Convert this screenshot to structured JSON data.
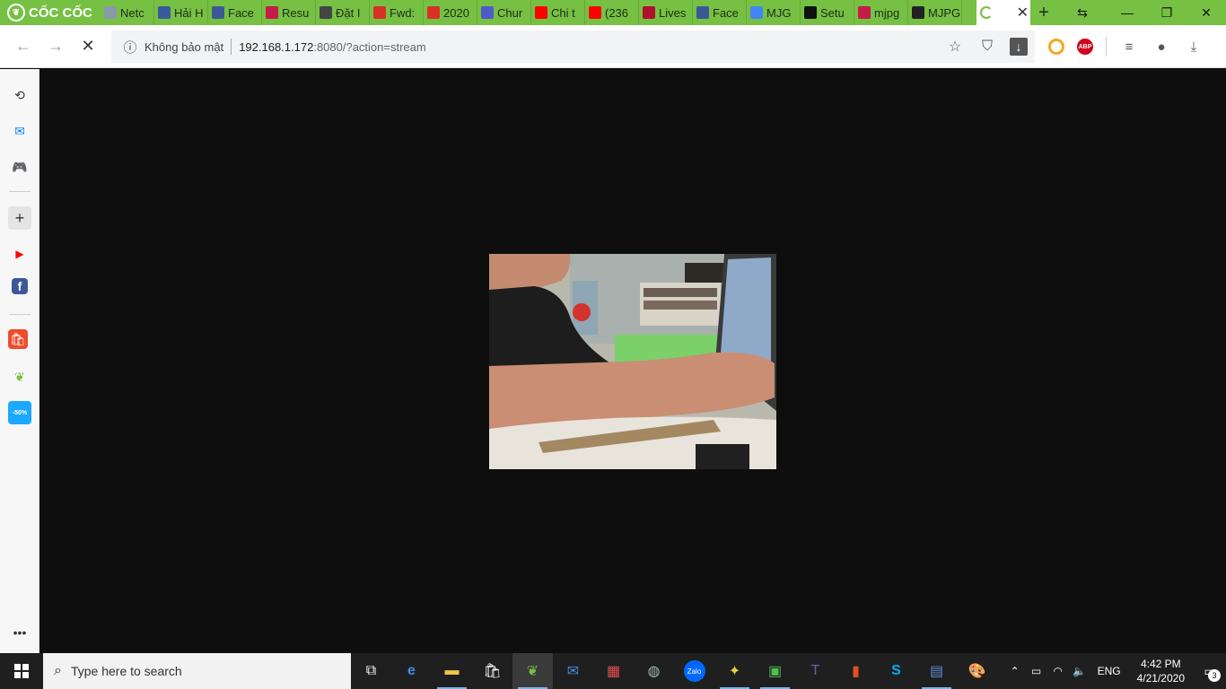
{
  "browser": {
    "brand": "CỐC CỐC",
    "tabs": [
      {
        "title": "Netc",
        "icon": "scissors-icon",
        "color": "#8899aa"
      },
      {
        "title": "Hải H",
        "icon": "facebook-icon",
        "color": "#3b5998"
      },
      {
        "title": "Face",
        "icon": "facebook-icon",
        "color": "#3b5998"
      },
      {
        "title": "Resu",
        "icon": "raspberry-icon",
        "color": "#c51a4a"
      },
      {
        "title": "Đặt I",
        "icon": "globe-icon",
        "color": "#444444"
      },
      {
        "title": "Fwd:",
        "icon": "gmail-icon",
        "color": "#d93025"
      },
      {
        "title": "2020",
        "icon": "gmail-icon",
        "color": "#d93025"
      },
      {
        "title": "Chur",
        "icon": "teams-icon",
        "color": "#5059c9"
      },
      {
        "title": "Chi t",
        "icon": "youtube-icon",
        "color": "#ff0000"
      },
      {
        "title": "(236",
        "icon": "youtube-icon",
        "color": "#ff0000"
      },
      {
        "title": "Lives",
        "icon": "r-icon",
        "color": "#b10f2e"
      },
      {
        "title": "Face",
        "icon": "facebook-icon",
        "color": "#3b5998"
      },
      {
        "title": "MJG",
        "icon": "google-icon",
        "color": "#4285f4"
      },
      {
        "title": "Setu",
        "icon": "github-icon",
        "color": "#111111"
      },
      {
        "title": "mjpg",
        "icon": "raspberry-icon",
        "color": "#c51a4a"
      },
      {
        "title": "MJPG",
        "icon": "terminal-icon",
        "color": "#222222"
      }
    ],
    "active_tab": {
      "title": "",
      "icon": "loading-icon"
    },
    "toolbar": {
      "security_label": "Không bảo mật",
      "url_host": "192.168.1.172",
      "url_rest": ":8080/?action=stream"
    }
  },
  "sidebar": {
    "items": [
      {
        "name": "history-icon",
        "glyph": "⟲",
        "color": "#333333"
      },
      {
        "name": "messenger-icon",
        "glyph": "✉",
        "color": "#0084ff"
      },
      {
        "name": "game-icon",
        "glyph": "🎮",
        "color": "#43a047"
      },
      {
        "name": "add-icon",
        "glyph": "+",
        "color": "#333333"
      },
      {
        "name": "youtube-icon",
        "glyph": "▶",
        "color": "#ff0000"
      },
      {
        "name": "facebook-icon",
        "glyph": "f",
        "color": "#3b5998"
      },
      {
        "name": "shopee-icon",
        "glyph": "🛍",
        "color": "#ee4d2d"
      },
      {
        "name": "coccoc-leaf-icon",
        "glyph": "❦",
        "color": "#76c043"
      },
      {
        "name": "tiki-icon",
        "glyph": "-50%",
        "color": "#1ba8ff"
      },
      {
        "name": "more-icon",
        "glyph": "•••",
        "color": "#333333"
      }
    ]
  },
  "taskbar": {
    "search_placeholder": "Type here to search",
    "lang": "ENG",
    "time": "4:42 PM",
    "date": "4/21/2020",
    "notifications": "3"
  }
}
